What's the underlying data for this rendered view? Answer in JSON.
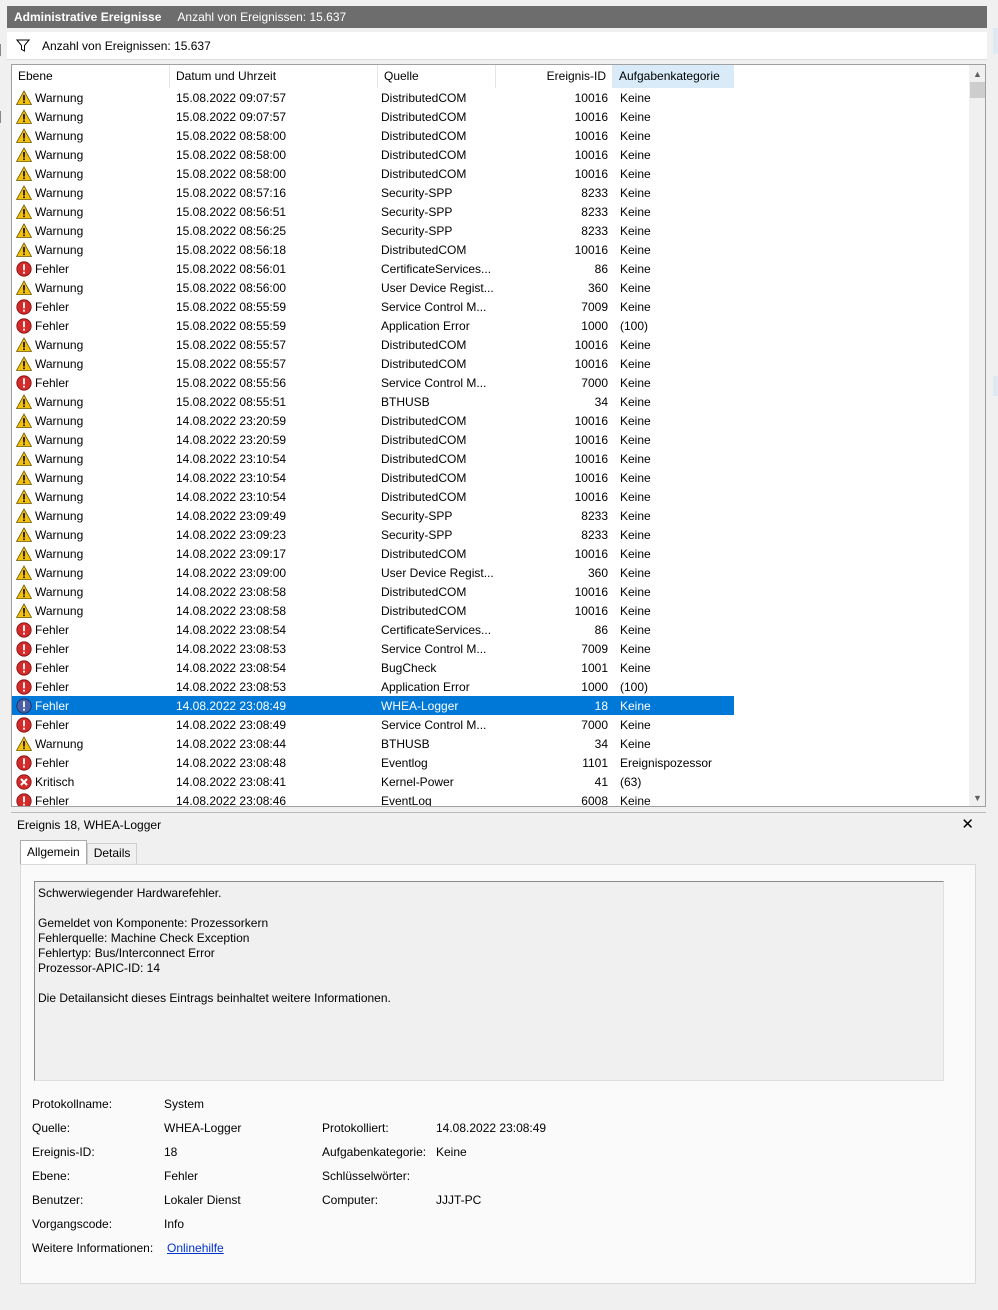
{
  "window": {
    "title": "Administrative Ereignisse",
    "count_label": "Anzahl von Ereignissen: 15.637"
  },
  "filter": {
    "label": "Anzahl von Ereignissen: 15.637",
    "icon": "filter-icon"
  },
  "columns": [
    "Ebene",
    "Datum und Uhrzeit",
    "Quelle",
    "Ereignis-ID",
    "Aufgabenkategorie"
  ],
  "events": [
    {
      "level": "Warnung",
      "date": "15.08.2022 09:07:57",
      "source": "DistributedCOM",
      "id": "10016",
      "category": "Keine"
    },
    {
      "level": "Warnung",
      "date": "15.08.2022 09:07:57",
      "source": "DistributedCOM",
      "id": "10016",
      "category": "Keine"
    },
    {
      "level": "Warnung",
      "date": "15.08.2022 08:58:00",
      "source": "DistributedCOM",
      "id": "10016",
      "category": "Keine"
    },
    {
      "level": "Warnung",
      "date": "15.08.2022 08:58:00",
      "source": "DistributedCOM",
      "id": "10016",
      "category": "Keine"
    },
    {
      "level": "Warnung",
      "date": "15.08.2022 08:58:00",
      "source": "DistributedCOM",
      "id": "10016",
      "category": "Keine"
    },
    {
      "level": "Warnung",
      "date": "15.08.2022 08:57:16",
      "source": "Security-SPP",
      "id": "8233",
      "category": "Keine"
    },
    {
      "level": "Warnung",
      "date": "15.08.2022 08:56:51",
      "source": "Security-SPP",
      "id": "8233",
      "category": "Keine"
    },
    {
      "level": "Warnung",
      "date": "15.08.2022 08:56:25",
      "source": "Security-SPP",
      "id": "8233",
      "category": "Keine"
    },
    {
      "level": "Warnung",
      "date": "15.08.2022 08:56:18",
      "source": "DistributedCOM",
      "id": "10016",
      "category": "Keine"
    },
    {
      "level": "Fehler",
      "date": "15.08.2022 08:56:01",
      "source": "CertificateServices...",
      "id": "86",
      "category": "Keine"
    },
    {
      "level": "Warnung",
      "date": "15.08.2022 08:56:00",
      "source": "User Device Regist...",
      "id": "360",
      "category": "Keine"
    },
    {
      "level": "Fehler",
      "date": "15.08.2022 08:55:59",
      "source": "Service Control M...",
      "id": "7009",
      "category": "Keine"
    },
    {
      "level": "Fehler",
      "date": "15.08.2022 08:55:59",
      "source": "Application Error",
      "id": "1000",
      "category": "(100)"
    },
    {
      "level": "Warnung",
      "date": "15.08.2022 08:55:57",
      "source": "DistributedCOM",
      "id": "10016",
      "category": "Keine"
    },
    {
      "level": "Warnung",
      "date": "15.08.2022 08:55:57",
      "source": "DistributedCOM",
      "id": "10016",
      "category": "Keine"
    },
    {
      "level": "Fehler",
      "date": "15.08.2022 08:55:56",
      "source": "Service Control M...",
      "id": "7000",
      "category": "Keine"
    },
    {
      "level": "Warnung",
      "date": "15.08.2022 08:55:51",
      "source": "BTHUSB",
      "id": "34",
      "category": "Keine"
    },
    {
      "level": "Warnung",
      "date": "14.08.2022 23:20:59",
      "source": "DistributedCOM",
      "id": "10016",
      "category": "Keine"
    },
    {
      "level": "Warnung",
      "date": "14.08.2022 23:20:59",
      "source": "DistributedCOM",
      "id": "10016",
      "category": "Keine"
    },
    {
      "level": "Warnung",
      "date": "14.08.2022 23:10:54",
      "source": "DistributedCOM",
      "id": "10016",
      "category": "Keine"
    },
    {
      "level": "Warnung",
      "date": "14.08.2022 23:10:54",
      "source": "DistributedCOM",
      "id": "10016",
      "category": "Keine"
    },
    {
      "level": "Warnung",
      "date": "14.08.2022 23:10:54",
      "source": "DistributedCOM",
      "id": "10016",
      "category": "Keine"
    },
    {
      "level": "Warnung",
      "date": "14.08.2022 23:09:49",
      "source": "Security-SPP",
      "id": "8233",
      "category": "Keine"
    },
    {
      "level": "Warnung",
      "date": "14.08.2022 23:09:23",
      "source": "Security-SPP",
      "id": "8233",
      "category": "Keine"
    },
    {
      "level": "Warnung",
      "date": "14.08.2022 23:09:17",
      "source": "DistributedCOM",
      "id": "10016",
      "category": "Keine"
    },
    {
      "level": "Warnung",
      "date": "14.08.2022 23:09:00",
      "source": "User Device Regist...",
      "id": "360",
      "category": "Keine"
    },
    {
      "level": "Warnung",
      "date": "14.08.2022 23:08:58",
      "source": "DistributedCOM",
      "id": "10016",
      "category": "Keine"
    },
    {
      "level": "Warnung",
      "date": "14.08.2022 23:08:58",
      "source": "DistributedCOM",
      "id": "10016",
      "category": "Keine"
    },
    {
      "level": "Fehler",
      "date": "14.08.2022 23:08:54",
      "source": "CertificateServices...",
      "id": "86",
      "category": "Keine"
    },
    {
      "level": "Fehler",
      "date": "14.08.2022 23:08:53",
      "source": "Service Control M...",
      "id": "7009",
      "category": "Keine"
    },
    {
      "level": "Fehler",
      "date": "14.08.2022 23:08:54",
      "source": "BugCheck",
      "id": "1001",
      "category": "Keine"
    },
    {
      "level": "Fehler",
      "date": "14.08.2022 23:08:53",
      "source": "Application Error",
      "id": "1000",
      "category": "(100)"
    },
    {
      "level": "Fehler",
      "date": "14.08.2022 23:08:49",
      "source": "WHEA-Logger",
      "id": "18",
      "category": "Keine",
      "selected": true
    },
    {
      "level": "Fehler",
      "date": "14.08.2022 23:08:49",
      "source": "Service Control M...",
      "id": "7000",
      "category": "Keine"
    },
    {
      "level": "Warnung",
      "date": "14.08.2022 23:08:44",
      "source": "BTHUSB",
      "id": "34",
      "category": "Keine"
    },
    {
      "level": "Fehler",
      "date": "14.08.2022 23:08:48",
      "source": "Eventlog",
      "id": "1101",
      "category": "Ereignispozessor"
    },
    {
      "level": "Kritisch",
      "date": "14.08.2022 23:08:41",
      "source": "Kernel-Power",
      "id": "41",
      "category": "(63)"
    },
    {
      "level": "Fehler",
      "date": "14.08.2022 23:08:46",
      "source": "EventLog",
      "id": "6008",
      "category": "Keine"
    }
  ],
  "detail": {
    "header": "Ereignis 18, WHEA-Logger",
    "tabs": [
      "Allgemein",
      "Details"
    ],
    "message": [
      "Schwerwiegender Hardwarefehler.",
      "",
      "Gemeldet von Komponente: Prozessorkern",
      "Fehlerquelle: Machine Check Exception",
      "Fehlertyp: Bus/Interconnect Error",
      "Prozessor-APIC-ID: 14",
      "",
      "Die Detailansicht dieses Eintrags beinhaltet weitere Informationen."
    ],
    "fields": {
      "protokollname_label": "Protokollname:",
      "protokollname": "System",
      "quelle_label": "Quelle:",
      "quelle": "WHEA-Logger",
      "protokolliert_label": "Protokolliert:",
      "protokolliert": "14.08.2022 23:08:49",
      "ereignisid_label": "Ereignis-ID:",
      "ereignisid": "18",
      "aufgabenkategorie_label": "Aufgabenkategorie:",
      "aufgabenkategorie": "Keine",
      "ebene_label": "Ebene:",
      "ebene": "Fehler",
      "schluesselwoerter_label": "Schlüsselwörter:",
      "schluesselwoerter": "",
      "benutzer_label": "Benutzer:",
      "benutzer": "Lokaler Dienst",
      "computer_label": "Computer:",
      "computer": "JJJT-PC",
      "vorgangscode_label": "Vorgangscode:",
      "vorgangscode": "Info",
      "weitere_label": "Weitere Informationen:",
      "weitere_link": "Onlinehilfe"
    }
  },
  "colors": {
    "selection": "#0078d7",
    "titlebar": "#6d6d6d",
    "header_selected": "#d9ebf9",
    "link": "#0033cc"
  }
}
